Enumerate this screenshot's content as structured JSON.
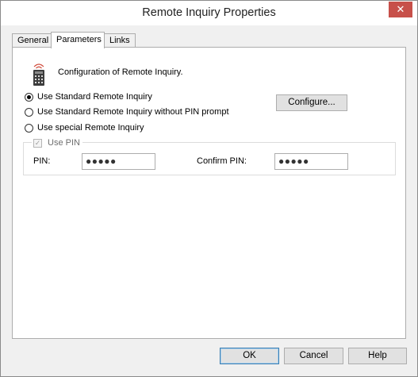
{
  "window": {
    "title": "Remote Inquiry Properties",
    "close_glyph": "✕"
  },
  "tabs": [
    {
      "label": "General",
      "active": false
    },
    {
      "label": "Parameters",
      "active": true
    },
    {
      "label": "Links",
      "active": false
    }
  ],
  "parameters": {
    "description": "Configuration of Remote Inquiry.",
    "icon": "remote-control-icon",
    "options": [
      {
        "label": "Use Standard Remote Inquiry",
        "selected": true
      },
      {
        "label": "Use Standard Remote Inquiry without PIN prompt",
        "selected": false
      },
      {
        "label": "Use special Remote Inquiry",
        "selected": false
      }
    ],
    "configure_label": "Configure...",
    "use_pin": {
      "label": "Use PIN",
      "checked": true,
      "enabled": false
    },
    "pin_label": "PIN:",
    "pin_value": "●●●●●",
    "confirm_pin_label": "Confirm PIN:",
    "confirm_pin_value": "●●●●●"
  },
  "footer": {
    "ok_label": "OK",
    "cancel_label": "Cancel",
    "help_label": "Help"
  },
  "colors": {
    "close_button": "#c7504a",
    "dialog_background": "#f0f0f0",
    "default_button_border": "#3c7fb1"
  }
}
